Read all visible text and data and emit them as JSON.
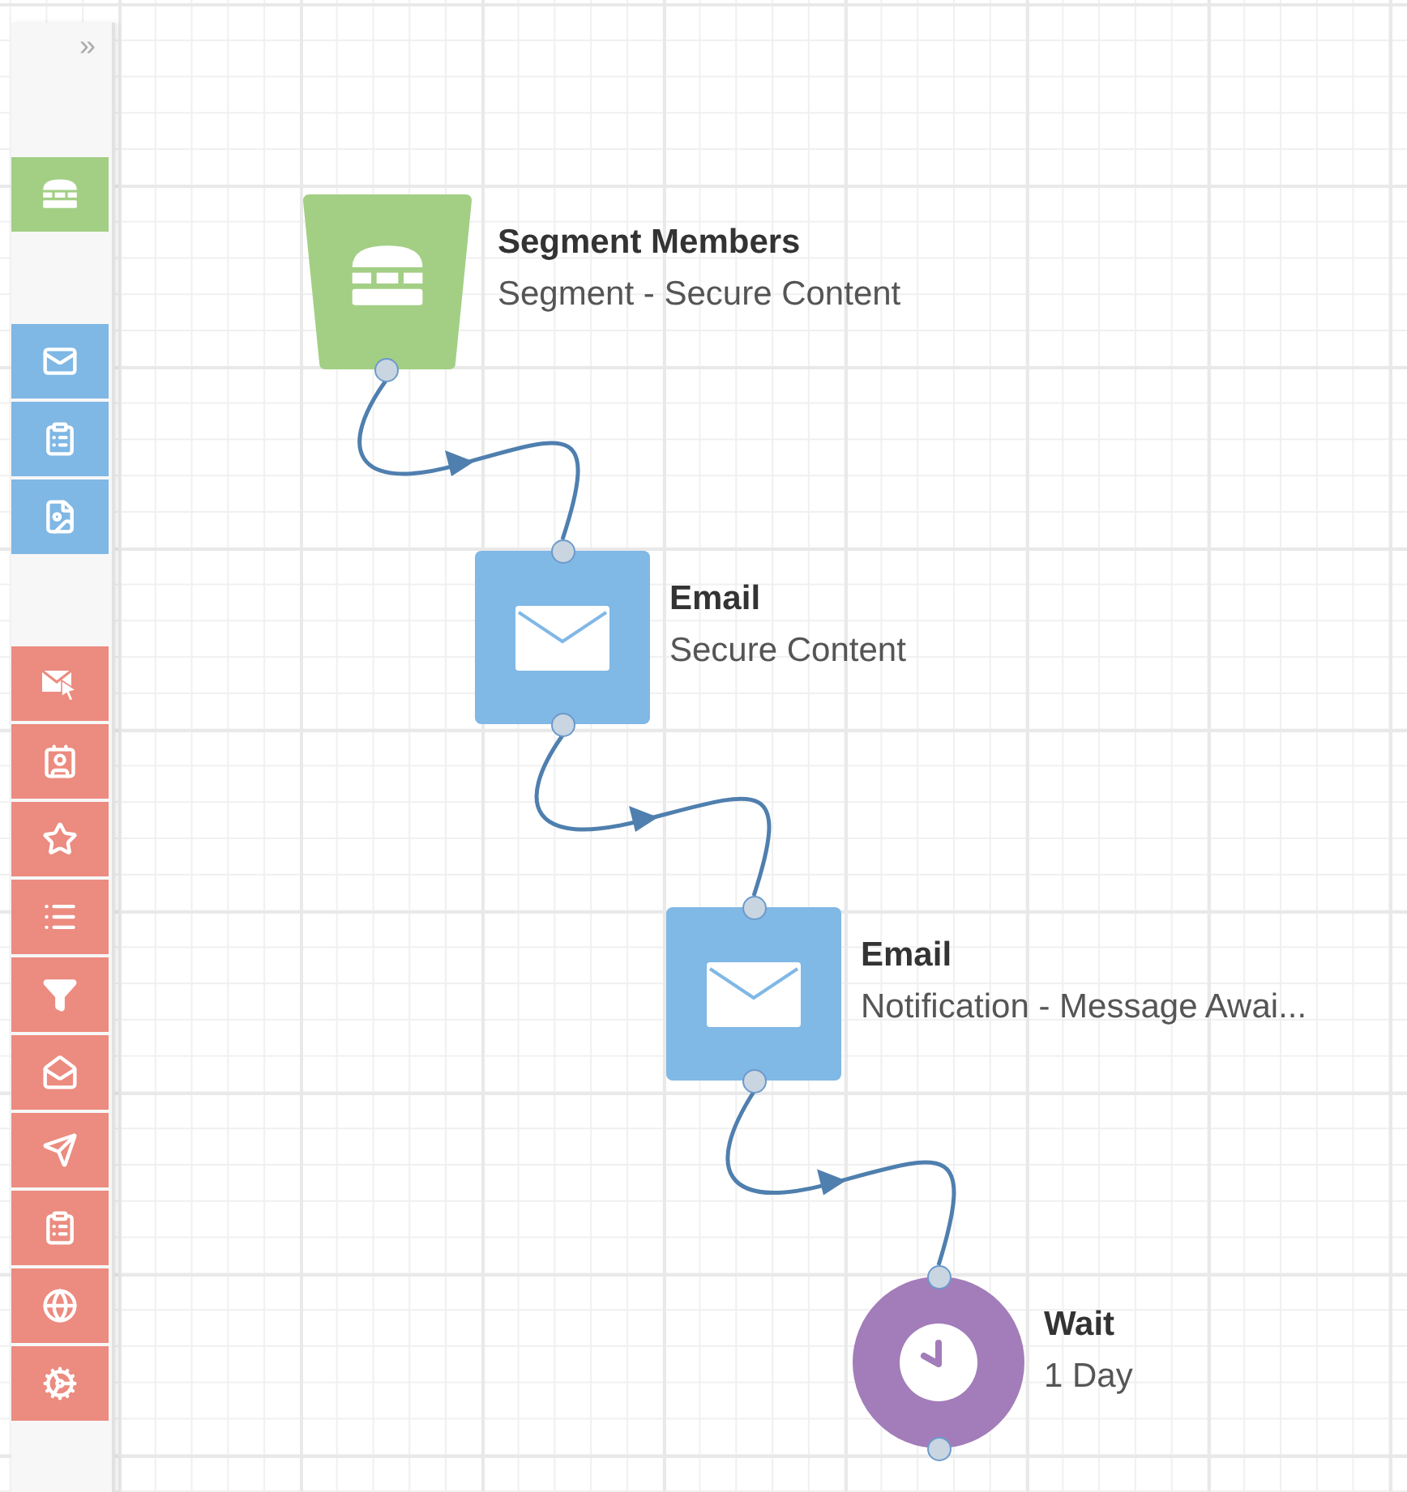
{
  "sidebar": {
    "toggle": "»",
    "groups": [
      {
        "color": "#a3cf85",
        "items": [
          {
            "kind": "segment"
          }
        ]
      },
      {
        "color": "#7fb7e5",
        "items": [
          {
            "kind": "email"
          },
          {
            "kind": "form"
          },
          {
            "kind": "landing-page"
          }
        ]
      },
      {
        "color": "#ec8b7f",
        "items": [
          {
            "kind": "email-click"
          },
          {
            "kind": "contact-card"
          },
          {
            "kind": "star-card"
          },
          {
            "kind": "list"
          },
          {
            "kind": "filter"
          },
          {
            "kind": "email-open"
          },
          {
            "kind": "email-send"
          },
          {
            "kind": "form"
          },
          {
            "kind": "globe"
          },
          {
            "kind": "gears"
          }
        ]
      }
    ]
  },
  "nodes": [
    {
      "kind": "segment",
      "title": "Segment Members",
      "subtitle": "Segment - Secure Content"
    },
    {
      "kind": "email",
      "title": "Email",
      "subtitle": "Secure Content"
    },
    {
      "kind": "email",
      "title": "Email",
      "subtitle": "Notification - Message Awai..."
    },
    {
      "kind": "wait",
      "title": "Wait",
      "subtitle": "1 Day"
    }
  ]
}
